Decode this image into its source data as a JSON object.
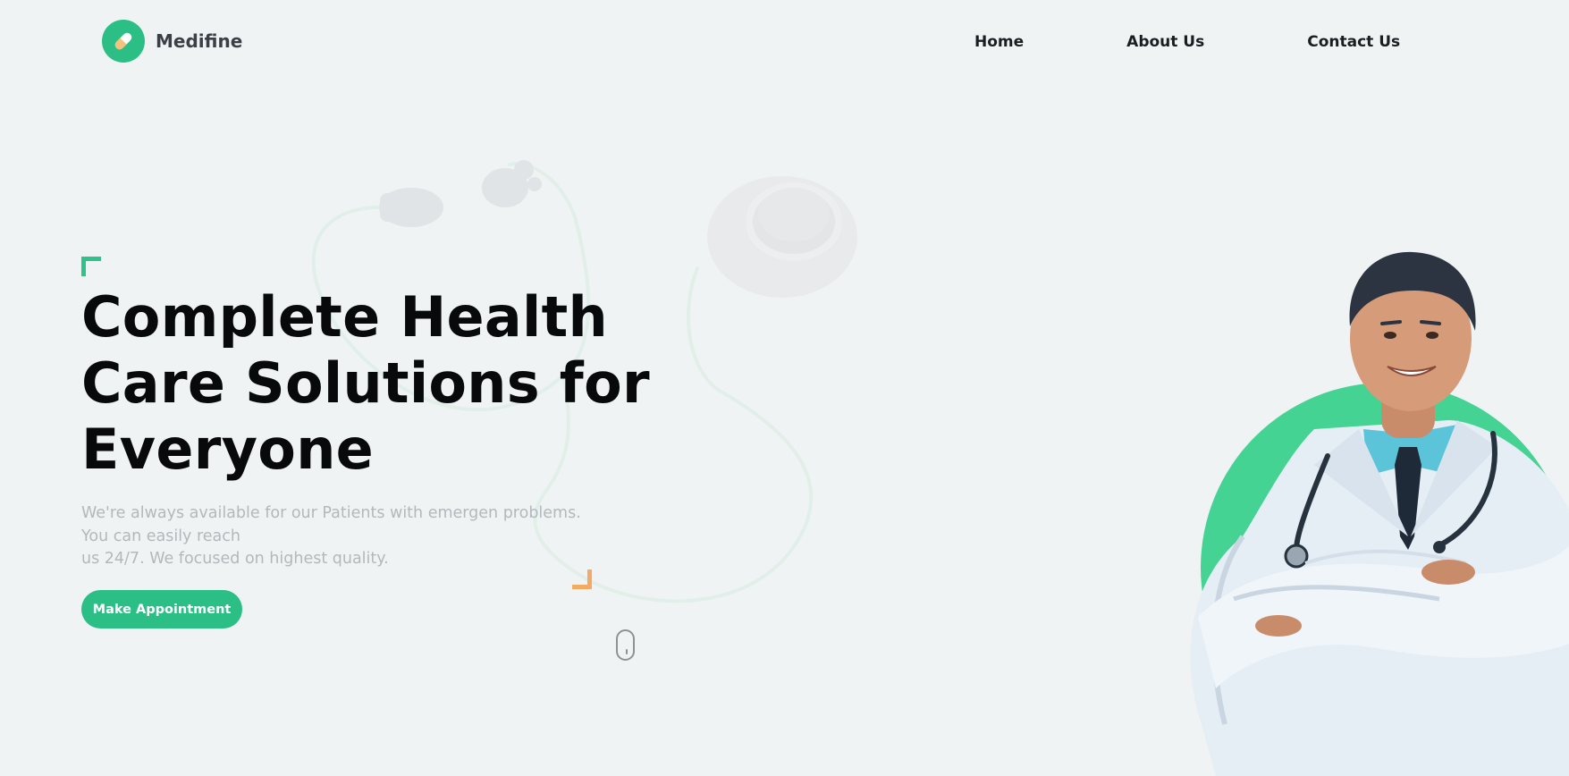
{
  "brand": {
    "name": "Medifine",
    "logo_icon": "pill-icon",
    "accent_color": "#2bbf86"
  },
  "nav": {
    "items": [
      {
        "label": "Home"
      },
      {
        "label": "About Us"
      },
      {
        "label": "Contact Us"
      }
    ]
  },
  "hero": {
    "title_lines": [
      "Complete Health",
      "Care Solutions for",
      "Everyone"
    ],
    "subtitle_lines": [
      "We're always available for our Patients with emergen problems.",
      "You can easily reach",
      "us 24/7. We focused on highest quality."
    ],
    "cta_label": "Make Appointment",
    "accent_corner_color": "#2fc38a",
    "secondary_corner_color": "#f4a965",
    "scroll_icon": "mouse-scroll-icon",
    "doctor_image": "doctor-portrait",
    "background_decoration": "stethoscope-icon"
  }
}
